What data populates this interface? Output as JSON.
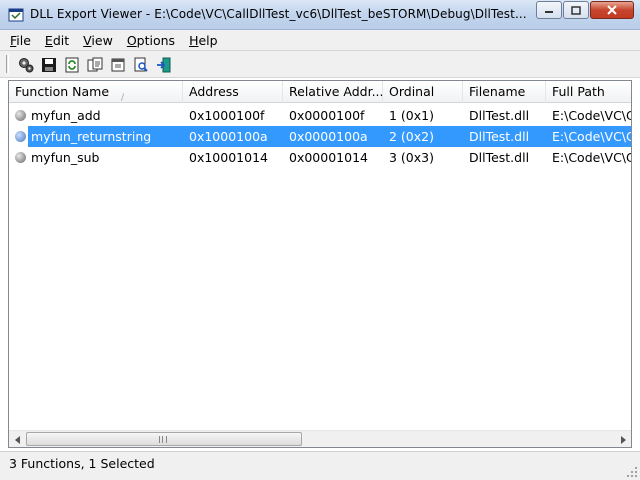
{
  "window": {
    "title": "DLL Export Viewer   -   E:\\Code\\VC\\CallDllTest_vc6\\DllTest_beSTORM\\Debug\\DllTest..."
  },
  "menu": [
    {
      "label": "File",
      "accel": "F",
      "rest": "ile"
    },
    {
      "label": "Edit",
      "accel": "E",
      "rest": "dit"
    },
    {
      "label": "View",
      "accel": "V",
      "rest": "iew"
    },
    {
      "label": "Options",
      "accel": "O",
      "rest": "ptions"
    },
    {
      "label": "Help",
      "accel": "H",
      "rest": "elp"
    }
  ],
  "toolbar": {
    "icons": [
      "properties-gear-icon",
      "save-icon",
      "refresh-icon",
      "copy-icon",
      "html-report-icon",
      "find-icon",
      "exit-icon"
    ]
  },
  "table": {
    "columns": [
      "Function Name",
      "Address",
      "Relative Addr...",
      "Ordinal",
      "Filename",
      "Full Path"
    ],
    "rows": [
      {
        "name": "myfun_add",
        "address": "0x1000100f",
        "relative": "0x0000100f",
        "ordinal": "1 (0x1)",
        "filename": "DllTest.dll",
        "fullpath": "E:\\Code\\VC\\C"
      },
      {
        "name": "myfun_returnstring",
        "address": "0x1000100a",
        "relative": "0x0000100a",
        "ordinal": "2 (0x2)",
        "filename": "DllTest.dll",
        "fullpath": "E:\\Code\\VC\\C"
      },
      {
        "name": "myfun_sub",
        "address": "0x10001014",
        "relative": "0x00001014",
        "ordinal": "3 (0x3)",
        "filename": "DllTest.dll",
        "fullpath": "E:\\Code\\VC\\C"
      }
    ],
    "selected_index": 1
  },
  "status": {
    "text": "3 Functions, 1 Selected"
  },
  "colors": {
    "selection": "#3399ff",
    "title_gradient_top": "#dbe7f5",
    "close_button": "#c8452e"
  }
}
